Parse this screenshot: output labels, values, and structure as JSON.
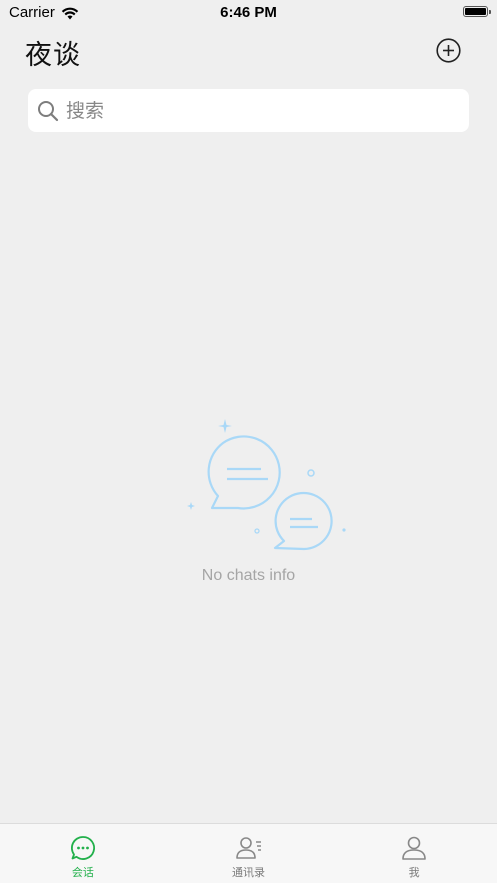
{
  "status_bar": {
    "carrier": "Carrier",
    "time": "6:46 PM"
  },
  "header": {
    "title": "夜谈",
    "add_icon": "plus-circle-icon"
  },
  "search": {
    "placeholder": "搜索",
    "value": ""
  },
  "empty_state": {
    "illustration_icon": "chat-bubbles-icon",
    "message": "No chats info"
  },
  "tab_bar": {
    "accent_color": "#22b04b",
    "inactive_color": "#7a7a7a",
    "tabs": [
      {
        "label": "会话",
        "icon": "chat-bubble-icon",
        "active": true
      },
      {
        "label": "通讯录",
        "icon": "contacts-icon",
        "active": false
      },
      {
        "label": "我",
        "icon": "person-icon",
        "active": false
      }
    ]
  }
}
